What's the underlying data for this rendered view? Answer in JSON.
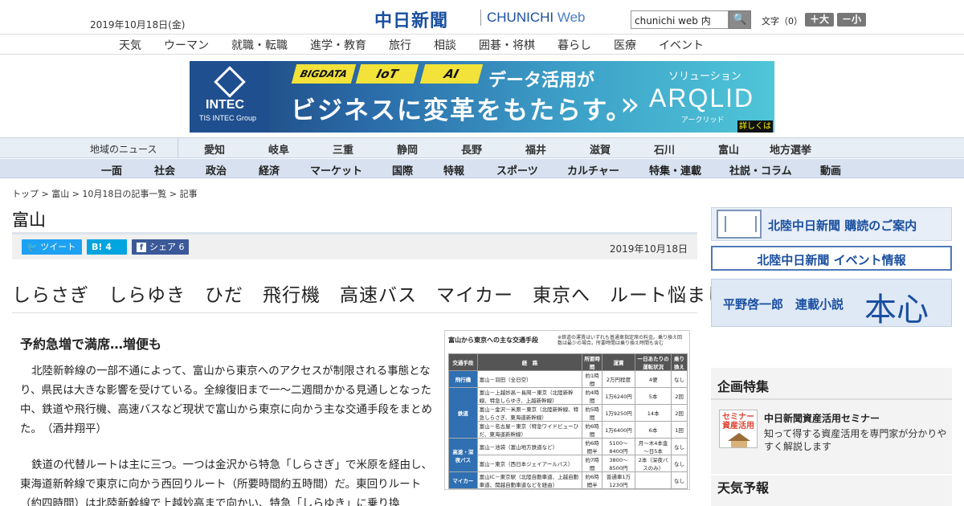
{
  "header": {
    "date": "2019年10月18日(金)",
    "logo_jp": "中日新聞",
    "logo_en_a": "CHUNICHI",
    "logo_en_b": "Web",
    "search_value": "chunichi web 内",
    "search_button": "🔍",
    "fontsize_label": "文字（0）",
    "font_bigger": "＋大",
    "font_smaller": "－小"
  },
  "nav_top": [
    "天気",
    "ウーマン",
    "就職・転職",
    "進学・教育",
    "旅行",
    "相談",
    "囲碁・将棋",
    "暮らし",
    "医療",
    "イベント"
  ],
  "banner": {
    "tags": [
      "BIGDATA",
      "IoT",
      "AI"
    ],
    "line1": "データ活用が",
    "line2": "ビジネスに変革をもたらす。",
    "solution": "ソリューション",
    "product": "ARQLID",
    "product_kana": "アークリッド",
    "more": "詳しくは",
    "brand": "INTEC",
    "brand_sub": "TIS INTEC Group"
  },
  "nav_region": {
    "label": "地域のニュース",
    "items": [
      "愛知",
      "岐阜",
      "三重",
      "静岡",
      "長野",
      "福井",
      "滋賀",
      "石川",
      "富山",
      "地方選挙"
    ]
  },
  "nav_section": [
    "一面",
    "社会",
    "政治",
    "経済",
    "マーケット",
    "国際",
    "特報",
    "スポーツ",
    "カルチャー",
    "特集・連載",
    "社説・コラム",
    "動画"
  ],
  "breadcrumb": "トップ > 富山 > 10月18日の記事一覧 > 記事",
  "article": {
    "prefecture": "富山",
    "tweet": "ツイート",
    "hatena": "B! 4",
    "share": "シェア 6",
    "date": "2019年10月18日",
    "headline": "しらさぎ　しらゆき　ひだ　飛行機　高速バス　マイカー　東京へ　ルート悩まし",
    "subhead": "予約急増で満席…増便も",
    "para1": "北陸新幹線の一部不通によって、富山から東京へのアクセスが制限される事態となり、県民は大きな影響を受けている。全線復旧まで一～二週間かかる見通しとなった中、鉄道や飛行機、高速バスなど現状で富山から東京に向かう主な交通手段をまとめた。　（酒井翔平）",
    "para2": "鉄道の代替ルートは主に三つ。一つは金沢から特急「しらさぎ」で米原を経由し、東海道新幹線で東京に向かう西回りルート（所要時間約五時間）だ。東回りルート（約四時間）は北陸新幹線で上越妙高まで向かい、特急「しらゆき」に乗り換"
  },
  "transport_table": {
    "title": "富山から東京への主な交通手段",
    "note": "※鉄道の運賃はいずれも普通車指定席の料金。乗り換え回数は最少の場合。所要時間は乗り換え時間も含む",
    "headers": [
      "交通手段",
      "経　路",
      "所要時間",
      "運賃",
      "一日あたりの運転状況",
      "乗り換え"
    ],
    "rows": [
      [
        "飛行機",
        "富山－羽田（全日空）",
        "約1時間",
        "2万円程度",
        "4便",
        "なし"
      ],
      [
        "鉄道",
        "富山－上越妙高－長岡－東京（北陸新幹線、特急しらゆき、上越新幹線）",
        "約4時間",
        "1万6240円",
        "5本",
        "2回"
      ],
      [
        "",
        "富山－金沢－米原－東京（北陸新幹線、特急しらさぎ、東海道新幹線）",
        "約5時間",
        "1万9250円",
        "14本",
        "2回"
      ],
      [
        "",
        "富山－名古屋－東京（特急ワイドビューひだ、東海道新幹線）",
        "約6時間",
        "1万6400円",
        "6本",
        "1回"
      ],
      [
        "高速・深夜バス",
        "富山－池袋（富山地方鉄道など）",
        "約6時間半",
        "5100～8400円",
        "月～木4本金～日5本",
        "なし"
      ],
      [
        "",
        "富山－東京（西日本ジェイアールバス）",
        "約7時間",
        "3800～8500円",
        "2本（深夜バスのみ）",
        "なし"
      ],
      [
        "マイカー",
        "富山IC－東京駅（北陸自動車道、上越自動車道、関越自動車道などを経由）",
        "約6時間半",
        "普通車1万1230円",
        "",
        "なし"
      ]
    ]
  },
  "sidebar": {
    "subscribe": "北陸中日新聞 購読のご案内",
    "event": "北陸中日新聞 イベント情報",
    "novel_author": "平野啓一郎　連載小説",
    "novel_title": "本心",
    "feature_heading": "企画特集",
    "feature_icon_text": "セミナー資産活用",
    "feature_title": "中日新聞資産活用セミナー",
    "feature_desc": "知って得する資産活用を専門家が分かりやすく解説します",
    "weather_heading": "天気予報"
  },
  "colors": {
    "brand_blue": "#1a4fa0",
    "twitter": "#1da1f2",
    "hatena": "#00a4de",
    "facebook": "#3b5998"
  }
}
